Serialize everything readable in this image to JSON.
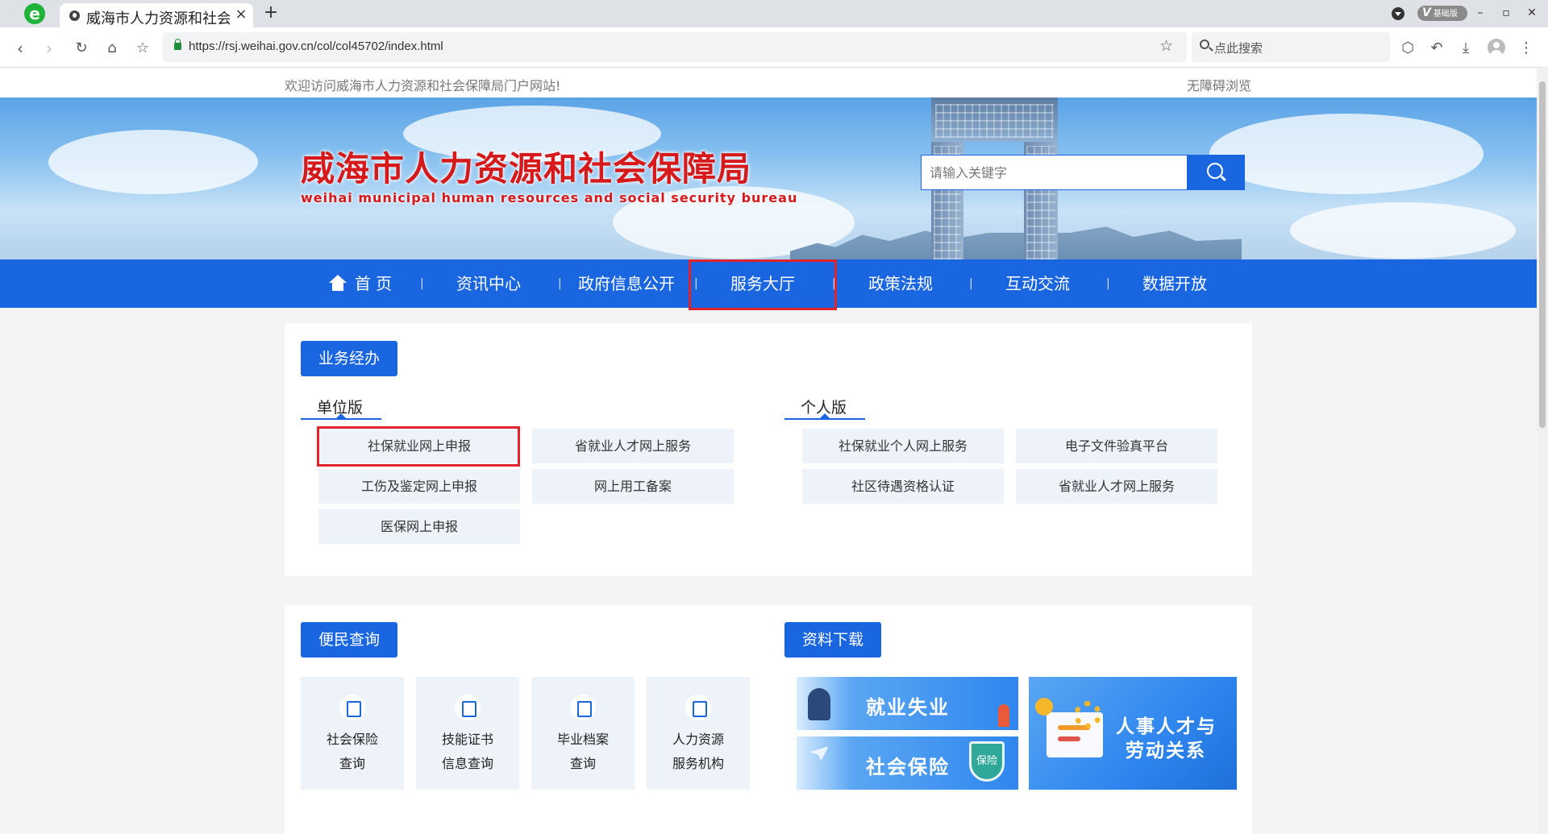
{
  "browser": {
    "logo_letter": "e",
    "tab_title": "威海市人力资源和社会保障局",
    "tab_close": "×",
    "new_tab": "+",
    "edition_badge_v": "V",
    "edition_badge": "基础版",
    "url": "https://rsj.weihai.gov.cn/col/col45702/index.html",
    "search_placeholder": "点此搜索",
    "win_minimize": "–",
    "win_restore": "▫",
    "win_close": "✕"
  },
  "top_bar": {
    "welcome": "欢迎访问威海市人力资源和社会保障局门户网站!",
    "accessible": "无障碍浏览"
  },
  "header": {
    "title": "威海市人力资源和社会保障局",
    "subtitle": "weihai municipal human resources and social security bureau",
    "search_placeholder": "请输入关键字"
  },
  "nav": {
    "items": [
      {
        "label": "首 页"
      },
      {
        "label": "资讯中心"
      },
      {
        "label": "政府信息公开"
      },
      {
        "label": "服务大厅"
      },
      {
        "label": "政策法规"
      },
      {
        "label": "互动交流"
      },
      {
        "label": "数据开放"
      }
    ],
    "separator": "|",
    "active": "服务大厅"
  },
  "business": {
    "title": "业务经办",
    "unit": {
      "label": "单位版",
      "items": [
        "社保就业网上申报",
        "省就业人才网上服务",
        "工伤及鉴定网上申报",
        "网上用工备案",
        "医保网上申报"
      ]
    },
    "personal": {
      "label": "个人版",
      "items": [
        "社保就业个人网上服务",
        "电子文件验真平台",
        "社区待遇资格认证",
        "省就业人才网上服务"
      ]
    }
  },
  "query": {
    "title": "便民查询",
    "cards": [
      {
        "line1": "社会保险",
        "line2": "查询"
      },
      {
        "line1": "技能证书",
        "line2": "信息查询"
      },
      {
        "line1": "毕业档案",
        "line2": "查询"
      },
      {
        "line1": "人力资源",
        "line2": "服务机构"
      }
    ]
  },
  "downloads": {
    "title": "资料下载",
    "employment": "就业失业",
    "insurance": "社会保险",
    "shield": "保险",
    "hr_line1": "人事人才与",
    "hr_line2": "劳动关系"
  },
  "colors": {
    "primary": "#1a66e0",
    "highlight": "#e0242c",
    "title_red": "#d6191b",
    "tile_bg": "#eef3fa"
  }
}
